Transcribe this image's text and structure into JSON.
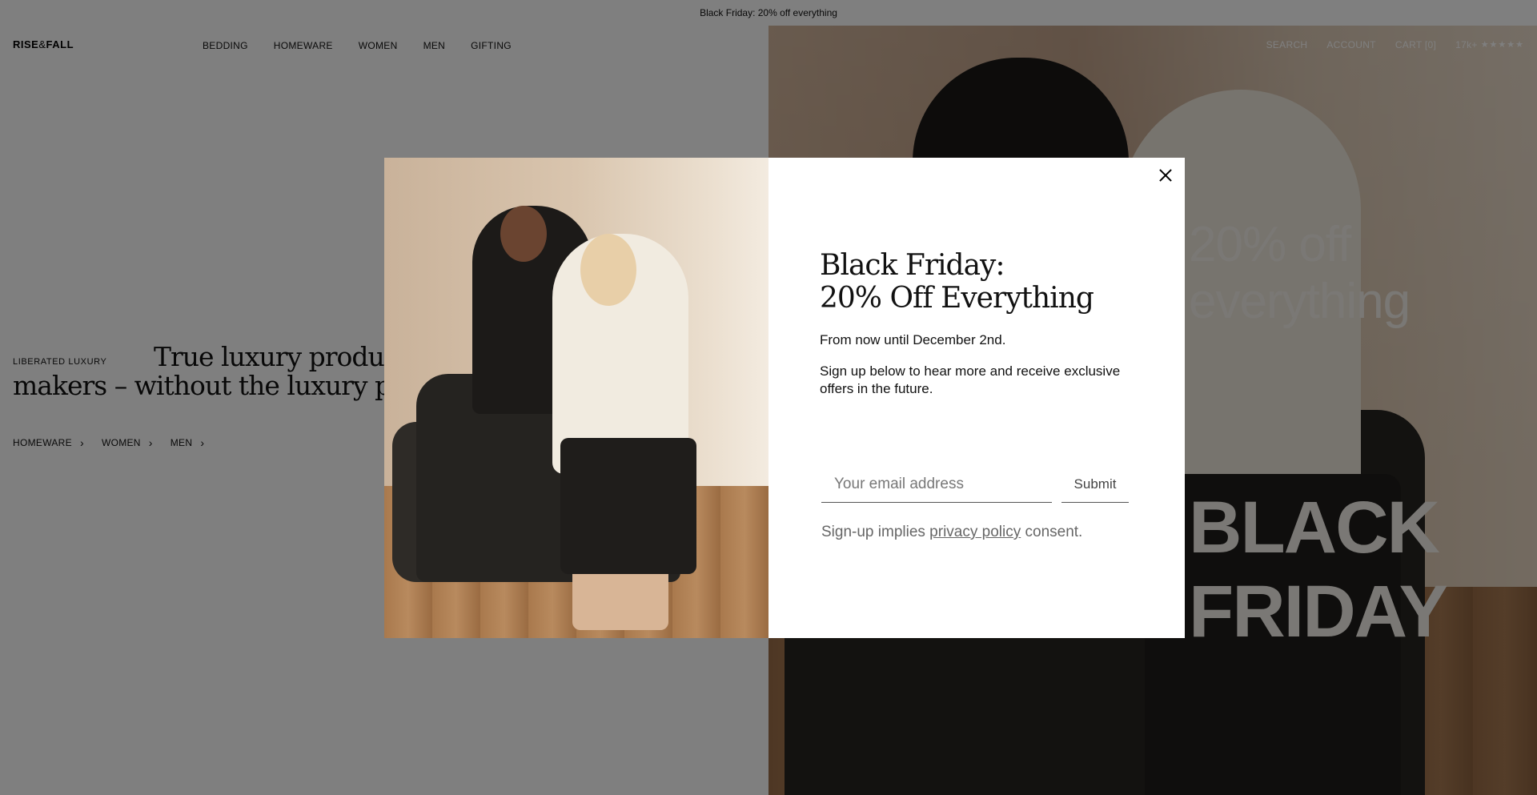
{
  "announcement": {
    "text": "Black Friday: 20% off everything"
  },
  "header": {
    "logo": {
      "part1": "RISE",
      "amp": "&",
      "part2": "FALL"
    },
    "nav": [
      "BEDDING",
      "HOMEWARE",
      "WOMEN",
      "MEN",
      "GIFTING"
    ],
    "search": "SEARCH",
    "account": "ACCOUNT",
    "cart": "CART [0]",
    "reviews_count": "17k+",
    "stars": "★★★★★"
  },
  "hero": {
    "eyebrow": "LIBERATED LUXURY",
    "tagline": "True luxury products from the world's best makers – without the luxury price tag.",
    "categories": [
      "HOMEWARE",
      "WOMEN",
      "MEN"
    ],
    "banner_line1": "20% off everything",
    "banner_line2": "BLACK FRIDAY"
  },
  "modal": {
    "title_line1": "Black Friday:",
    "title_line2": "20% Off Everything",
    "subtitle": "From now until December 2nd.",
    "body": "Sign up below to hear more and receive exclusive offers in the future.",
    "email_placeholder": "Your email address",
    "submit_label": "Submit",
    "consent_prefix": "Sign-up implies ",
    "consent_link": "privacy policy",
    "consent_suffix": " consent."
  },
  "colors": {
    "overlay": "#000000",
    "modal_bg": "#ffffff",
    "text": "#111111"
  },
  "icons": {
    "close": "close-icon",
    "chevron": "chevron-right-icon",
    "star": "star-icon"
  }
}
